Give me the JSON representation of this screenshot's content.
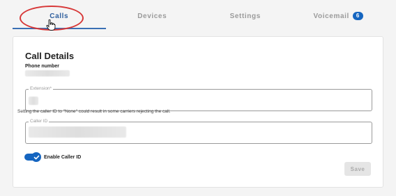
{
  "tabs": [
    {
      "label": "Calls",
      "active": true
    },
    {
      "label": "Devices",
      "active": false
    },
    {
      "label": "Settings",
      "active": false
    },
    {
      "label": "Voicemail",
      "active": false,
      "badge": "6"
    }
  ],
  "card": {
    "title": "Call Details",
    "phone_label": "Phone number"
  },
  "fields": {
    "extension_label": "Extension*",
    "caller_id_label": "Caller ID"
  },
  "hint": "Setting the caller ID to \"None\" could result in some carriers rejecting the call.",
  "toggle": {
    "label": "Enable Caller ID",
    "on": true
  },
  "save_label": "Save",
  "colors": {
    "accent": "#1565c0",
    "annotation": "#d73737"
  }
}
